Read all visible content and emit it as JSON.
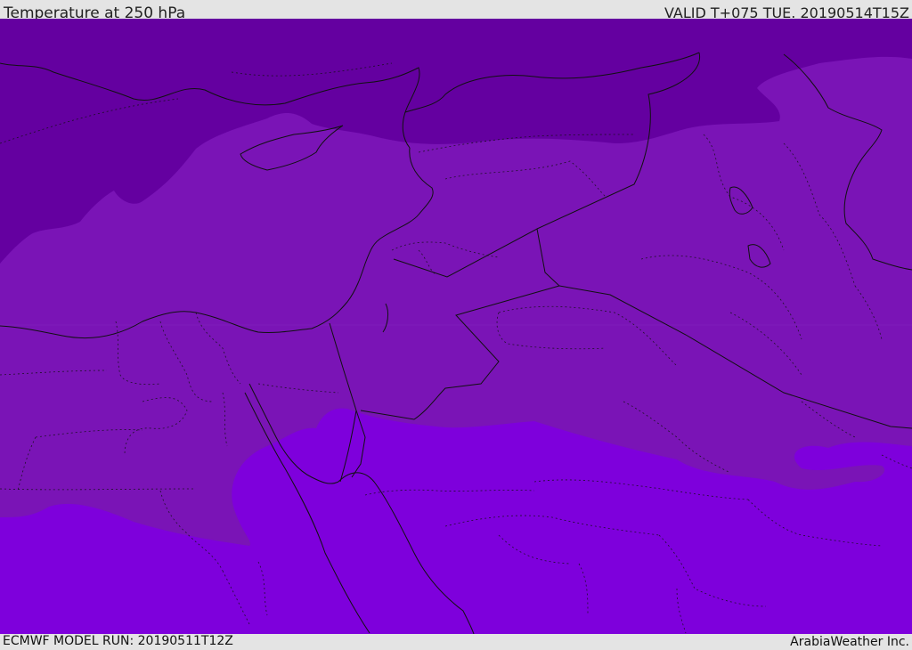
{
  "header": {
    "title": "Temperature at 250 hPa",
    "valid": "VALID T+075 TUE. 20190514T15Z"
  },
  "footer": {
    "model_run": "ECMWF MODEL RUN: 20190511T12Z",
    "credit": "ArabiaWeather Inc."
  },
  "map": {
    "field": "temperature",
    "level": "250 hPa",
    "colors": {
      "coldest_band": "#6400a0",
      "middle_band": "#7a14b6",
      "warmest_band": "#7e00dc",
      "borders": "#111111"
    }
  }
}
